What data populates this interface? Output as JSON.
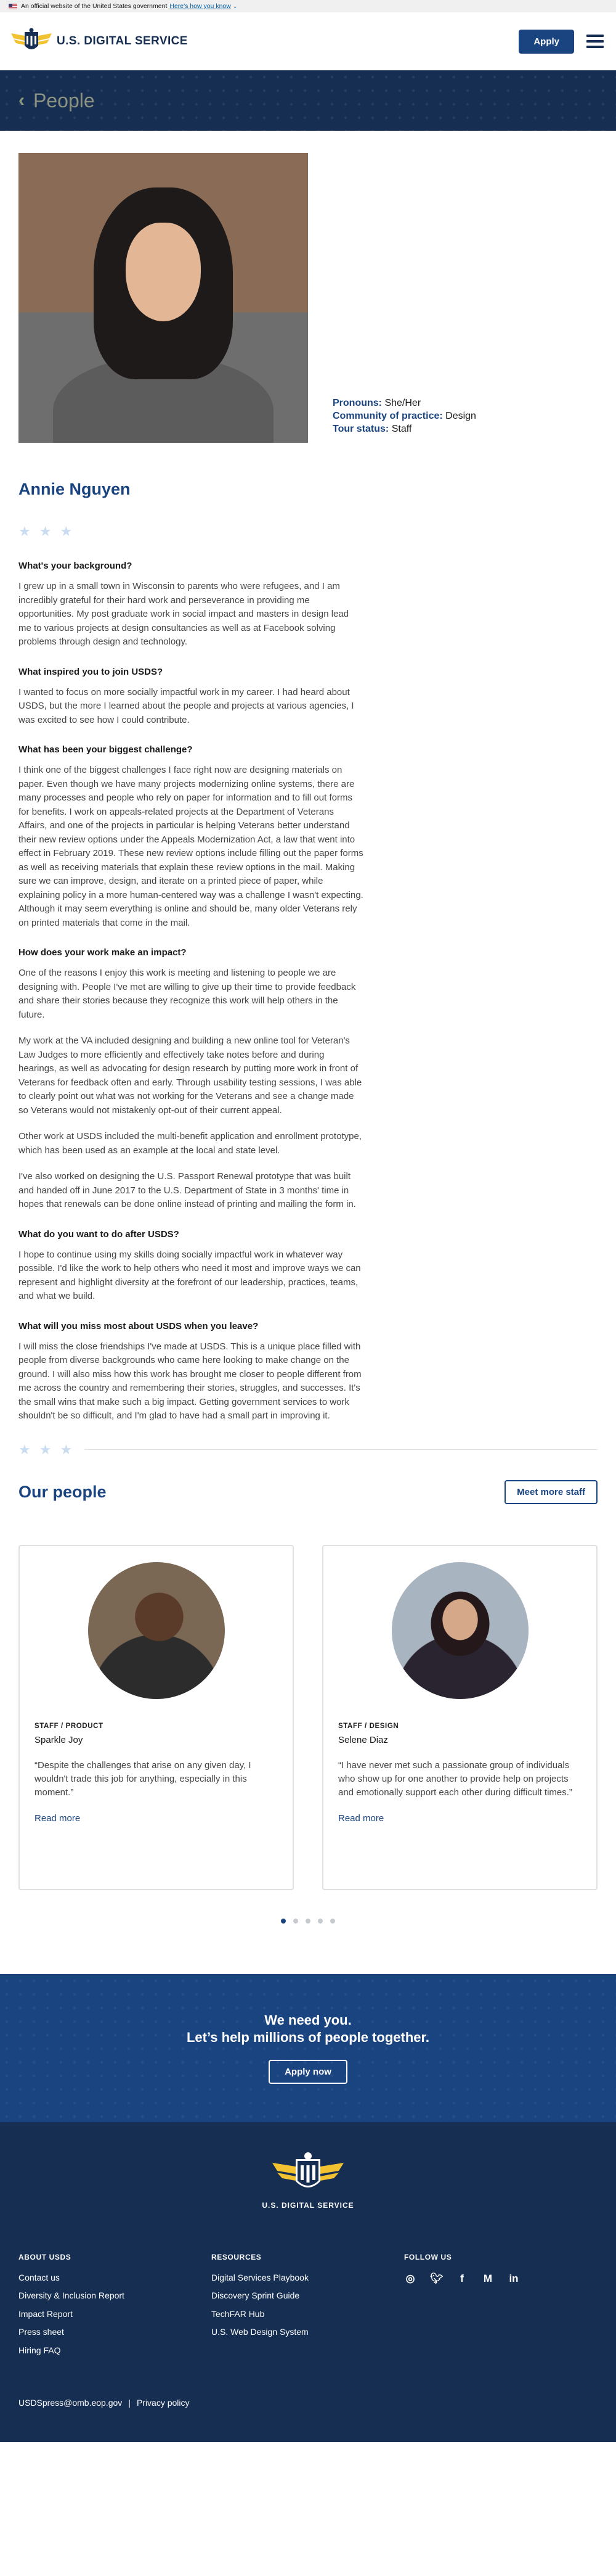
{
  "banner": {
    "text": "An official website of the United States government",
    "link": "Here's how you know"
  },
  "header": {
    "logo_text": "U.S. DIGITAL SERVICE",
    "apply_label": "Apply"
  },
  "hero": {
    "title": "People"
  },
  "profile": {
    "pronouns_label": "Pronouns:",
    "pronouns": "She/Her",
    "practice_label": "Community of practice:",
    "practice": "Design",
    "tour_label": "Tour status:",
    "tour": "Staff",
    "name": "Annie Nguyen"
  },
  "article": [
    {
      "q": "What's your background?",
      "p": [
        "I grew up in a small town in Wisconsin to parents who were refugees, and I am incredibly grateful for their hard work and perseverance in providing me opportunities. My post graduate work in social impact and masters in design lead me to various projects at design consultancies as well as at Facebook solving problems through design and technology."
      ]
    },
    {
      "q": "What inspired you to join USDS?",
      "p": [
        "I wanted to focus on more socially impactful work in my career. I had heard about USDS, but the more I learned about the people and projects at various agencies, I was excited to see how I could contribute."
      ]
    },
    {
      "q": "What has been your biggest challenge?",
      "p": [
        "I think one of the biggest challenges I face right now are designing materials on paper. Even though we have many projects modernizing online systems, there are many processes and people who rely on paper for information and to fill out forms for benefits. I work on appeals-related projects at the Department of Veterans Affairs, and one of the projects in particular is helping Veterans better understand their new review options under the Appeals Modernization Act, a law that went into effect in February 2019. These new review options include filling out the paper forms as well as receiving materials that explain these review options in the mail. Making sure we can improve, design, and iterate on a printed piece of paper, while explaining policy in a more human-centered way was a challenge I wasn't expecting. Although it may seem everything is online and should be, many older Veterans rely on printed materials that come in the mail."
      ]
    },
    {
      "q": "How does your work make an impact?",
      "p": [
        "One of the reasons I enjoy this work is meeting and listening to people we are designing with. People I've met are willing to give up their time to provide feedback and share their stories because they recognize this work will help others in the future.",
        "My work at the VA included designing and building a new online tool for Veteran's Law Judges to more efficiently and effectively take notes before and during hearings, as well as advocating for design research by putting more work in front of Veterans for feedback often and early. Through usability testing sessions, I was able to clearly point out what was not working for the Veterans and see a change made so Veterans would not mistakenly opt-out of their current appeal.",
        "Other work at USDS included the multi-benefit application and enrollment prototype, which has been used as an example at the local and state level.",
        "I've also worked on designing the U.S. Passport Renewal prototype that was built and handed off in June 2017 to the U.S. Department of State in 3 months' time in hopes that renewals can be done online instead of printing and mailing the form in."
      ]
    },
    {
      "q": "What do you want to do after USDS?",
      "p": [
        "I hope to continue using my skills doing socially impactful work in whatever way possible. I'd like the work to help others who need it most and improve ways we can represent and highlight diversity at the forefront of our leadership, practices, teams, and what we build."
      ]
    },
    {
      "q": "What will you miss most about USDS when you leave?",
      "p": [
        "I will miss the close friendships I've made at USDS. This is a unique place filled with people from diverse backgrounds who came here looking to make change on the ground. I will also miss how this work has brought me closer to people different from me across the country and remembering their stories, struggles, and successes. It's the small wins that make such a big impact. Getting government services to work shouldn't be so difficult, and I'm glad to have had a small part in improving it."
      ]
    }
  ],
  "our_people": {
    "title": "Our people",
    "more_label": "Meet more staff",
    "cards": [
      {
        "role": "STAFF / PRODUCT",
        "name": "Sparkle Joy",
        "quote": "“Despite the challenges that arise on any given day, I wouldn't trade this job for anything, especially in this moment.”",
        "read": "Read more"
      },
      {
        "role": "STAFF / DESIGN",
        "name": "Selene Diaz",
        "quote": "“I have never met such a passionate group of individuals who show up for one another to provide help on projects and emotionally support each other during difficult times.”",
        "read": "Read more"
      }
    ]
  },
  "cta": {
    "line1": "We need you.",
    "line2": "Let’s help millions of people together.",
    "button": "Apply now"
  },
  "footer": {
    "logo_text": "U.S. DIGITAL SERVICE",
    "about": {
      "title": "ABOUT USDS",
      "links": [
        "Contact us",
        "Diversity & Inclusion Report",
        "Impact Report",
        "Press sheet",
        "Hiring FAQ"
      ]
    },
    "resources": {
      "title": "RESOURCES",
      "links": [
        "Digital Services Playbook",
        "Discovery Sprint Guide",
        "TechFAR Hub",
        "U.S. Web Design System"
      ]
    },
    "follow": {
      "title": "FOLLOW US",
      "icons": [
        "instagram-icon",
        "twitter-icon",
        "facebook-icon",
        "medium-icon",
        "linkedin-icon"
      ]
    },
    "email": "USDSpress@omb.eop.gov",
    "privacy": "Privacy policy"
  }
}
